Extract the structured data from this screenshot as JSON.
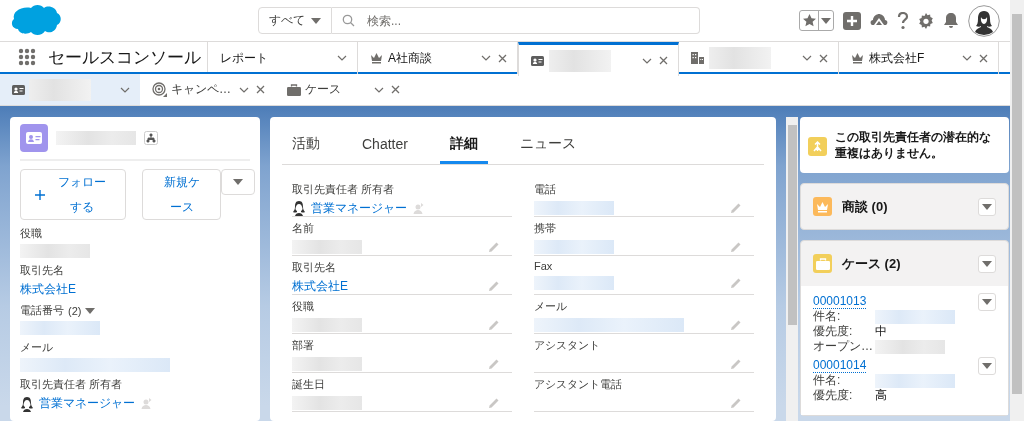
{
  "header": {
    "scope": "すべて",
    "search_placeholder": "検索..."
  },
  "nav": {
    "app_name": "セールスコンソール",
    "tabs": [
      {
        "kind": "text",
        "label": "レポート",
        "selected": false,
        "closable": false
      },
      {
        "kind": "text",
        "label": "A社商談",
        "selected": false,
        "closable": true
      },
      {
        "kind": "redacted",
        "selected": true,
        "closable": true
      },
      {
        "kind": "redacted",
        "selected": false,
        "closable": true
      },
      {
        "kind": "text",
        "label": "株式会社F",
        "selected": false,
        "closable": true
      }
    ]
  },
  "subtabs": [
    {
      "kind": "redacted",
      "selected": true,
      "closable": false
    },
    {
      "kind": "text",
      "label": "キャンペ…",
      "selected": false,
      "closable": true
    },
    {
      "kind": "text",
      "label": "ケース",
      "selected": false,
      "closable": true
    }
  ],
  "highlights": {
    "buttons": [
      {
        "label": "フォローする",
        "kind": "follow"
      },
      {
        "label": "新規ケース",
        "kind": "menu"
      }
    ],
    "fields": [
      {
        "label": "役職",
        "kind": "redacted"
      },
      {
        "label": "取引先名",
        "kind": "link",
        "value": "株式会社E"
      },
      {
        "label": "電話番号",
        "count": "(2)",
        "dropdown": true,
        "kind": "redacted_link"
      },
      {
        "label": "メール",
        "kind": "redacted_link_wide"
      },
      {
        "label": "取引先責任者 所有者",
        "kind": "owner",
        "value": "営業マネージャー"
      }
    ]
  },
  "detail": {
    "tabs": [
      {
        "label": "活動",
        "selected": false
      },
      {
        "label": "Chatter",
        "selected": false
      },
      {
        "label": "詳細",
        "selected": true
      },
      {
        "label": "ニュース",
        "selected": false
      }
    ],
    "columns": [
      [
        {
          "label": "取引先責任者 所有者",
          "kind": "owner",
          "value": "営業マネージャー"
        },
        {
          "label": "名前",
          "kind": "redacted",
          "editable": true
        },
        {
          "label": "取引先名",
          "kind": "link",
          "value": "株式会社E",
          "editable": true
        },
        {
          "label": "役職",
          "kind": "redacted",
          "editable": true
        },
        {
          "label": "部署",
          "kind": "redacted",
          "editable": true
        },
        {
          "label": "誕生日",
          "kind": "redacted",
          "editable": true
        }
      ],
      [
        {
          "label": "電話",
          "kind": "redacted_link",
          "editable": true
        },
        {
          "label": "携帯",
          "kind": "redacted_link",
          "editable": true
        },
        {
          "label": "Fax",
          "kind": "redacted_link",
          "editable": true
        },
        {
          "label": "メール",
          "kind": "redacted_link_wide",
          "editable": true
        },
        {
          "label": "アシスタント",
          "kind": "blank",
          "editable": true
        },
        {
          "label": "アシスタント電話",
          "kind": "blank",
          "editable": true
        }
      ]
    ]
  },
  "sidebar": {
    "duplicate_notice": "この取引先責任者の潜在的な重複はありません。",
    "related": [
      {
        "title": "商談 (0)",
        "color": "#fcb95b"
      },
      {
        "title": "ケース (2)",
        "color": "#f2cf5b"
      }
    ],
    "cases": [
      {
        "number": "00001013",
        "fields": [
          {
            "label": "件名:",
            "kind": "redacted_link"
          },
          {
            "label": "優先度:",
            "kind": "text",
            "value": "中"
          },
          {
            "label": "オープン…",
            "kind": "redacted"
          }
        ]
      },
      {
        "number": "00001014",
        "fields": [
          {
            "label": "件名:",
            "kind": "redacted_link"
          },
          {
            "label": "優先度:",
            "kind": "text",
            "value": "高"
          }
        ]
      }
    ]
  }
}
